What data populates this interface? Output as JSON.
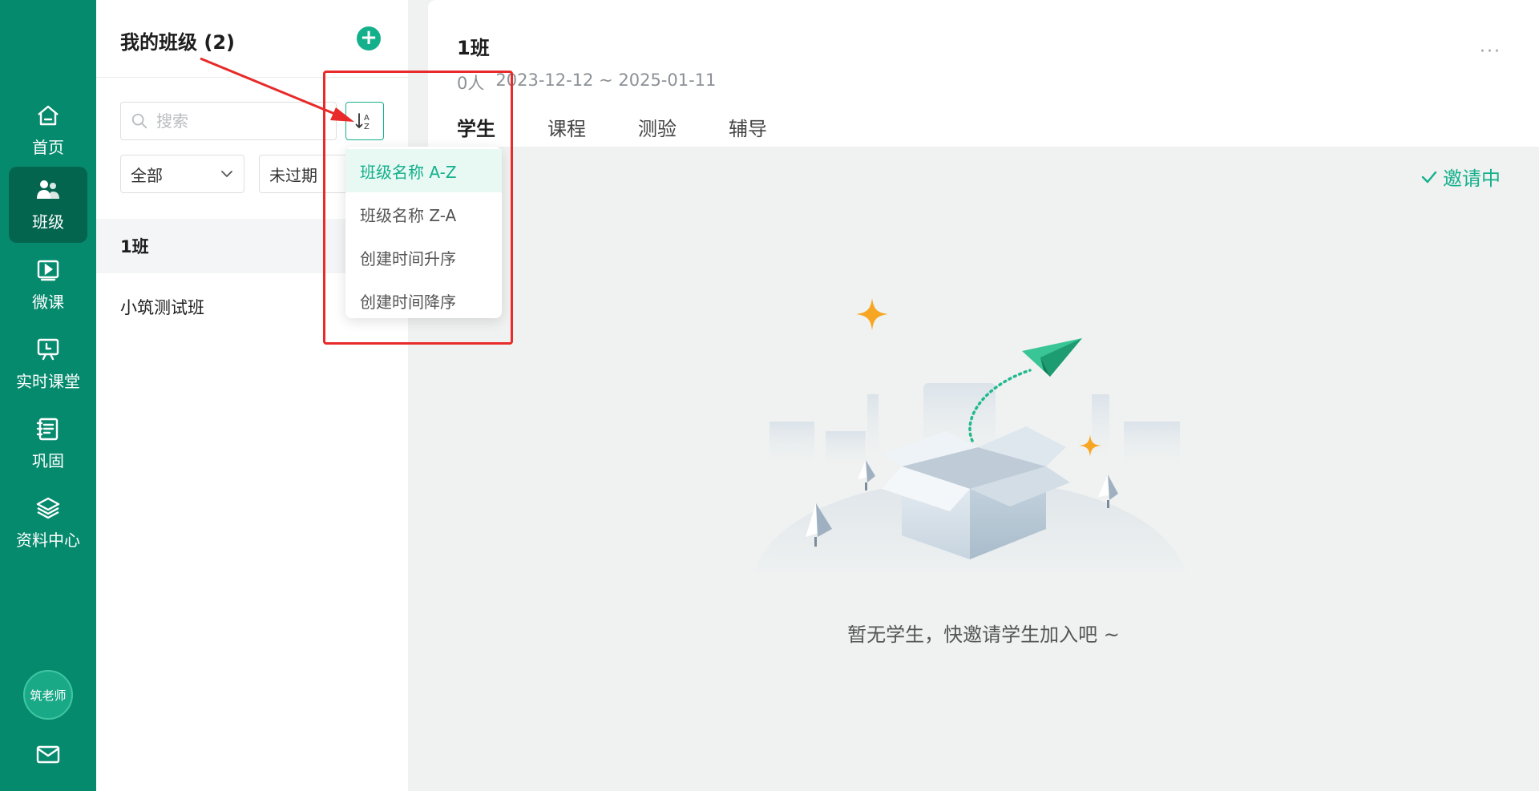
{
  "nav": {
    "items": [
      {
        "label": "首页",
        "icon": "home-icon"
      },
      {
        "label": "班级",
        "icon": "users-icon"
      },
      {
        "label": "微课",
        "icon": "video-icon"
      },
      {
        "label": "实时课堂",
        "icon": "classroom-icon"
      },
      {
        "label": "巩固",
        "icon": "notebook-icon"
      },
      {
        "label": "资料中心",
        "icon": "layers-icon"
      }
    ],
    "active_index": 1,
    "avatar": "筑老师",
    "mail_icon": "mail-icon"
  },
  "class_panel": {
    "title": "我的班级 (2)",
    "search_placeholder": "搜索",
    "filter_scope": "全部",
    "filter_status": "未过期",
    "classes": [
      "1班",
      "小筑测试班"
    ]
  },
  "sort_menu": {
    "options": [
      "班级名称 A-Z",
      "班级名称 Z-A",
      "创建时间升序",
      "创建时间降序"
    ],
    "selected_index": 0
  },
  "detail": {
    "class_name": "1班",
    "people": "0人",
    "date_range": "2023-12-12 ~ 2025-01-11",
    "more": "···",
    "tabs": [
      "学生",
      "课程",
      "测验",
      "辅导"
    ],
    "active_tab": 0,
    "inviting": "邀请中",
    "empty_text": "暂无学生，快邀请学生加入吧 ~"
  },
  "colors": {
    "rail": "#068a6e",
    "accent": "#14b08c",
    "annotation": "#e82a2a"
  }
}
